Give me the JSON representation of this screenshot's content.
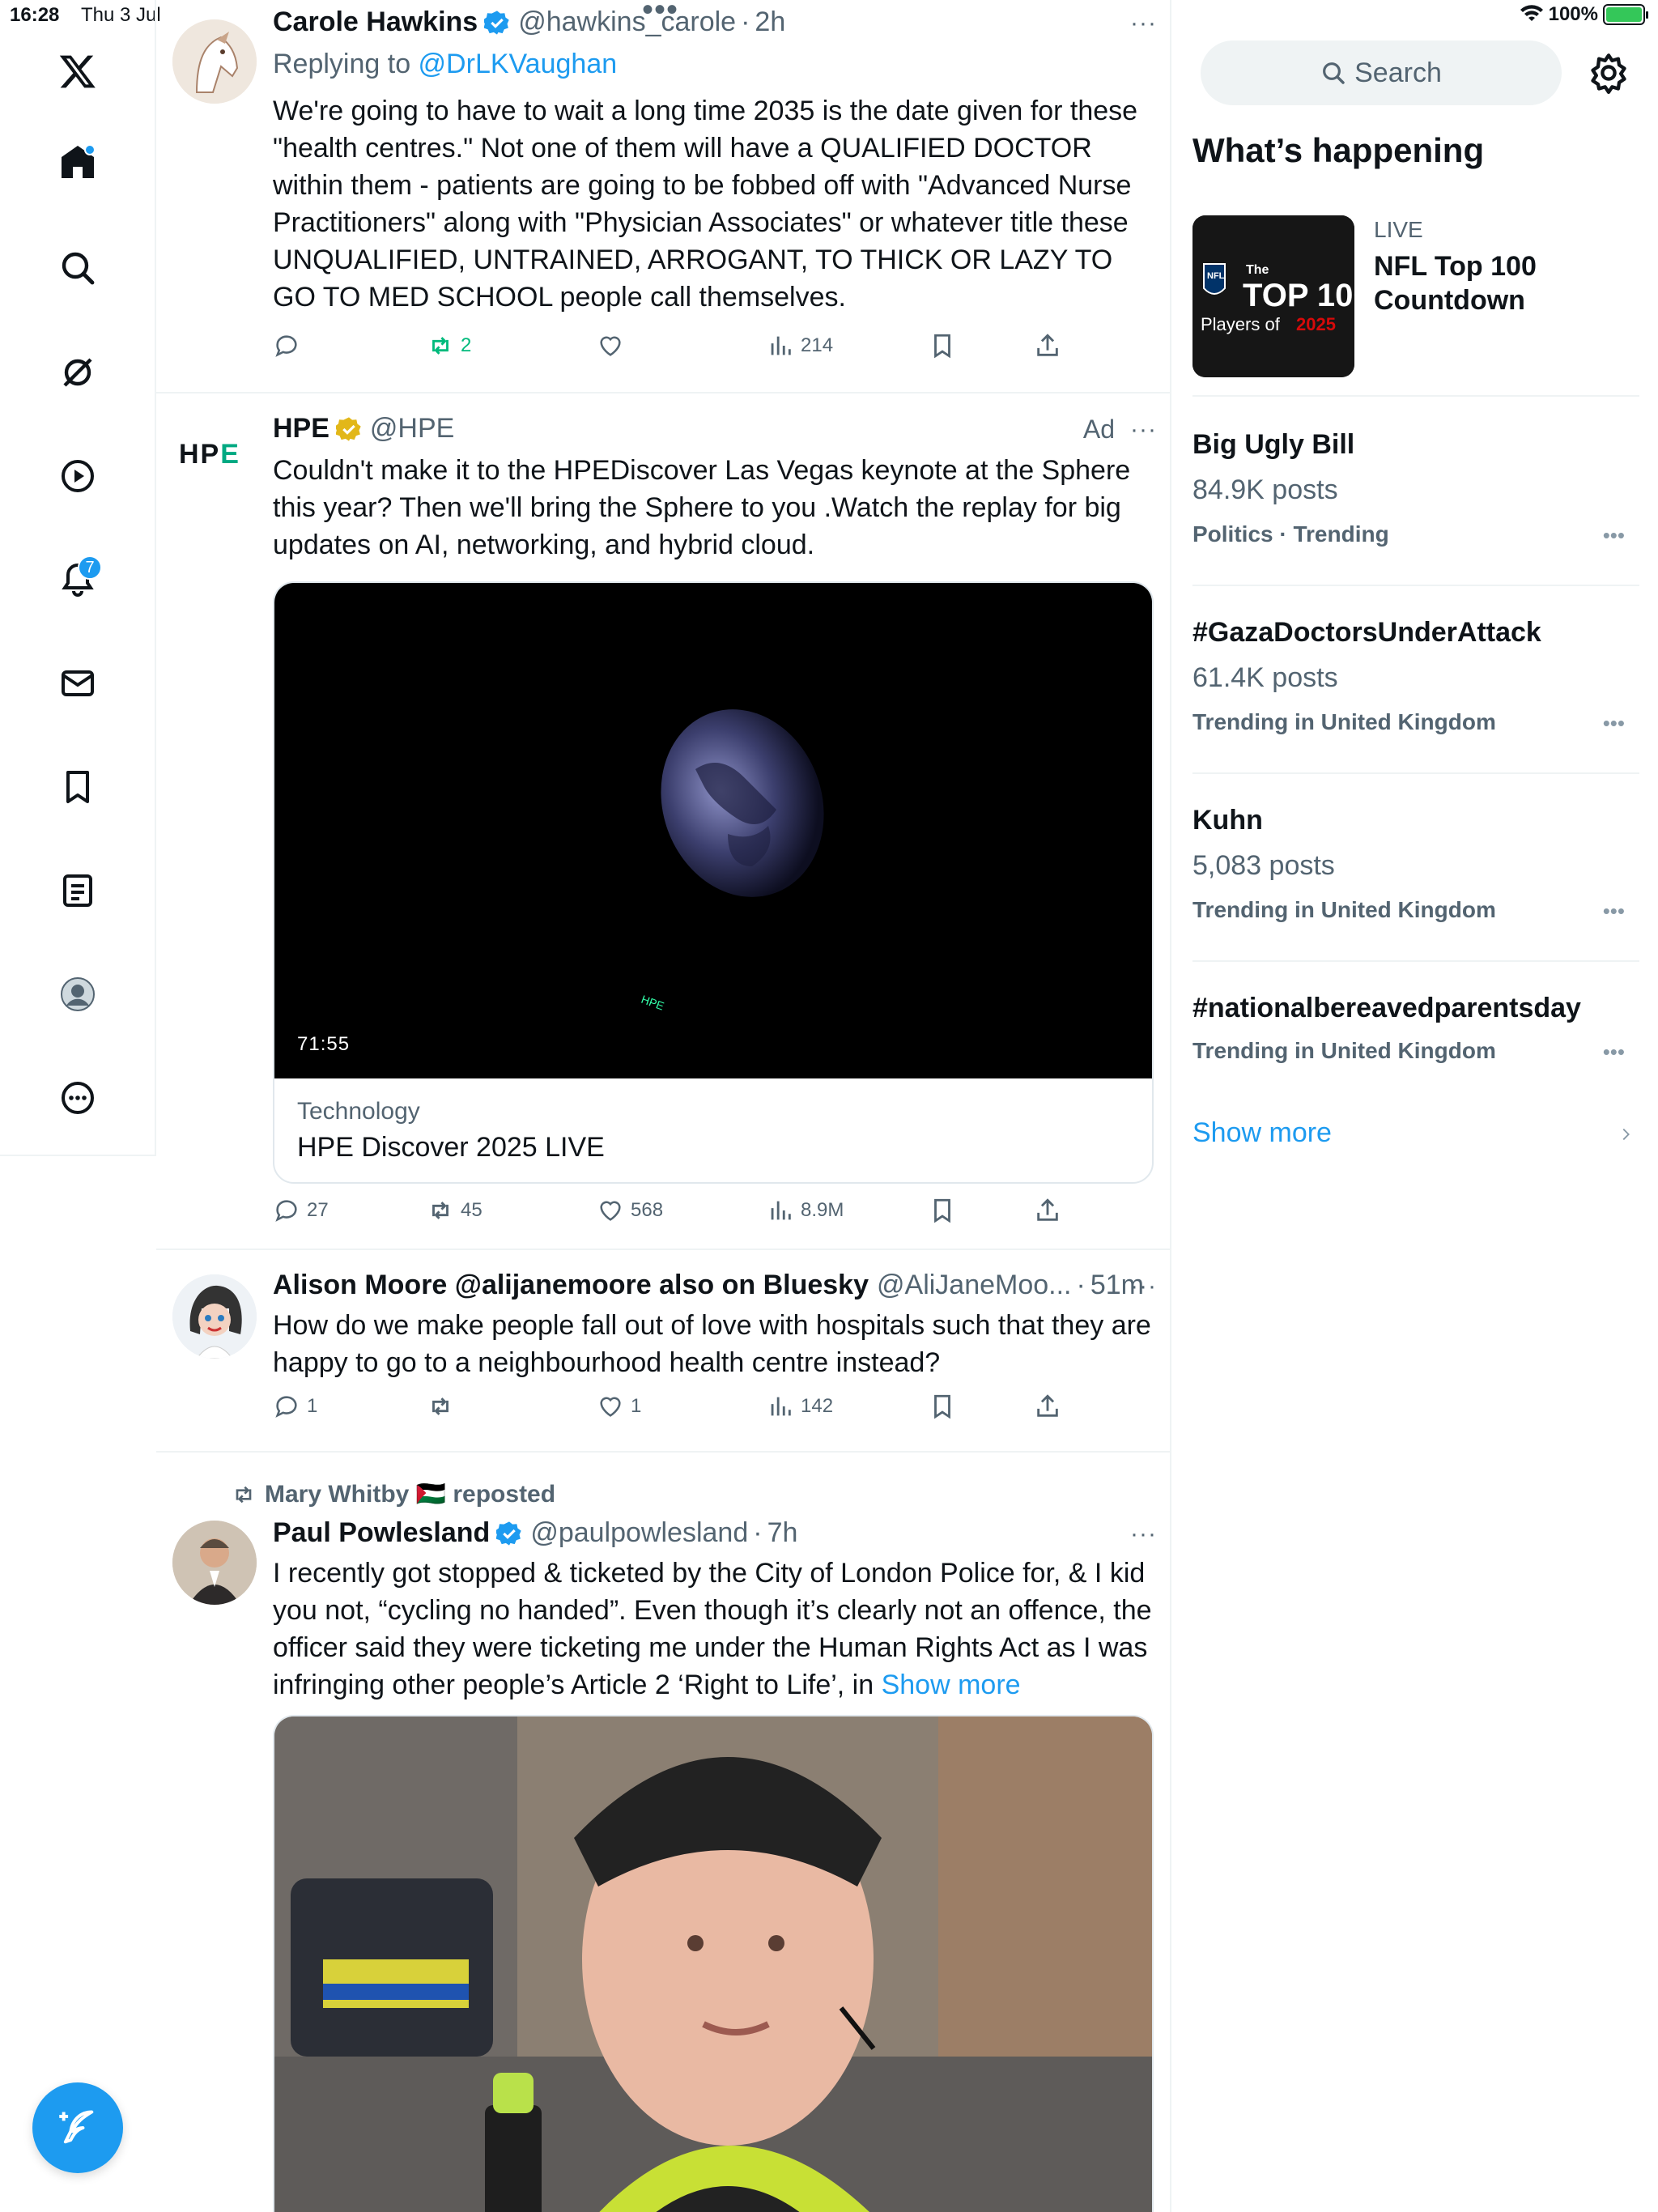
{
  "status": {
    "time": "16:28",
    "date": "Thu 3 Jul",
    "battery": "100%"
  },
  "nav": {
    "notifications_count": "7"
  },
  "tweets": [
    {
      "name": "Carole Hawkins",
      "handle": "@hawkins_carole",
      "time": "2h",
      "replying_prefix": "Replying to ",
      "replying_to": "@DrLKVaughan",
      "text": "We're going to have to wait a long time 2035 is the date given for these \"health centres.\" Not one of them will have a QUALIFIED DOCTOR within them - patients are going to be fobbed off with \"Advanced Nurse Practitioners\" along with \"Physician Associates\" or whatever title these UNQUALIFIED, UNTRAINED, ARROGANT, TO THICK OR LAZY TO GO TO MED SCHOOL people call themselves.",
      "replies": "",
      "reposts": "2",
      "likes": "",
      "views": "214"
    },
    {
      "name": "HPE",
      "handle": "@HPE",
      "ad": "Ad",
      "text": "Couldn't make it to the HPEDiscover Las Vegas keynote at the Sphere this year? Then we'll bring the Sphere to you .Watch the replay for big updates on AI, networking, and hybrid cloud.",
      "video_duration": "71:55",
      "card_category": "Technology",
      "card_title": "HPE Discover 2025 LIVE",
      "replies": "27",
      "reposts": "45",
      "likes": "568",
      "views": "8.9M"
    },
    {
      "name": "Alison Moore @alijanemoore also on Bluesky",
      "handle": "@AliJaneMoo...",
      "time": "51m",
      "text": "How do we make people fall out of love with hospitals such that they are happy to go to a neighbourhood health centre instead?",
      "replies": "1",
      "reposts": "",
      "likes": "1",
      "views": "142"
    },
    {
      "reposted_by": "Mary Whitby 🇵🇸 reposted",
      "name": "Paul Powlesland",
      "handle": "@paulpowlesland",
      "time": "7h",
      "text": "I recently got stopped & ticketed by the City of London Police for, & I kid you not, “cycling no handed”. Even though it’s clearly not an offence, the officer said they were ticketing me under the Human Rights Act as I was infringing other people’s Article 2 ‘Right to Life’, in ",
      "show_more": "Show more"
    }
  ],
  "search": {
    "placeholder": "Search"
  },
  "whats_happening": {
    "title": "What’s happening",
    "live_label": "LIVE",
    "live_title": "NFL Top 100 Countdown",
    "trends": [
      {
        "title": "Big Ugly Bill",
        "posts": "84.9K posts",
        "context": "Politics · Trending"
      },
      {
        "title": "#GazaDoctorsUnderAttack",
        "posts": "61.4K posts",
        "context": "Trending in United Kingdom"
      },
      {
        "title": "Kuhn",
        "posts": "5,083 posts",
        "context": "Trending in United Kingdom"
      },
      {
        "title": "#nationalbereavedparentsday",
        "posts": "",
        "context": "Trending in United Kingdom"
      }
    ],
    "show_more": "Show more"
  },
  "colors": {
    "accent": "#1d9bf0",
    "text": "#0f1419",
    "secondary": "#536471",
    "repost_active": "#00ba7c",
    "verified_gold": "#e2b719"
  }
}
